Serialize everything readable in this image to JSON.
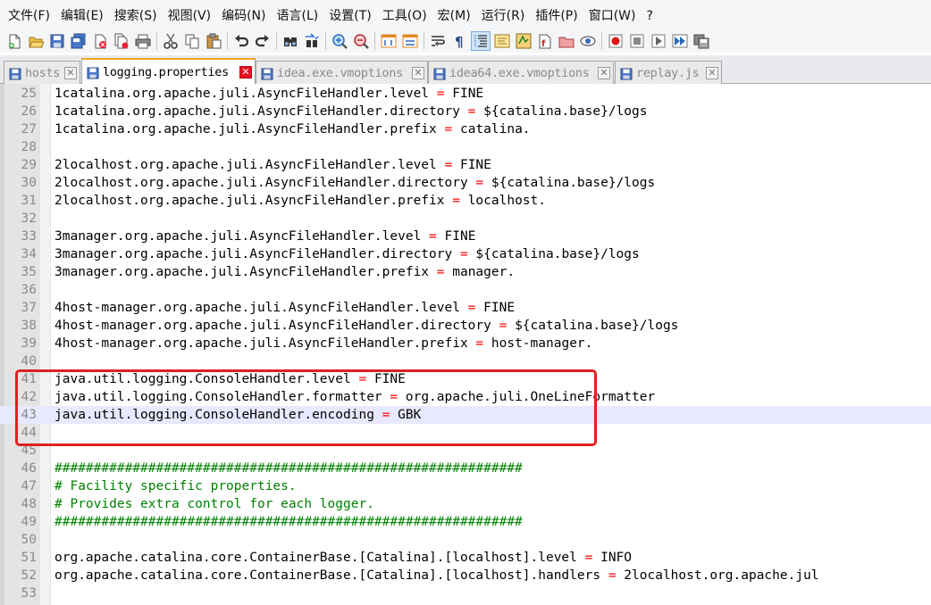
{
  "menubar": {
    "items": [
      "文件(F)",
      "编辑(E)",
      "搜索(S)",
      "视图(V)",
      "编码(N)",
      "语言(L)",
      "设置(T)",
      "工具(O)",
      "宏(M)",
      "运行(R)",
      "插件(P)",
      "窗口(W)",
      "?"
    ]
  },
  "toolbar": {
    "icons": [
      "new-file",
      "open-file",
      "save",
      "save-all",
      "close",
      "close-all",
      "print",
      "cut",
      "copy",
      "paste",
      "undo",
      "redo",
      "find",
      "replace",
      "zoom-in",
      "zoom-out",
      "sync-vertical",
      "sync-horizontal",
      "word-wrap",
      "show-all-characters",
      "indent-guide",
      "document-map",
      "function-list",
      "user-defined-language",
      "folder-as-workspace",
      "monitoring",
      "start-recording",
      "stop-recording",
      "playback",
      "run-macro-multiple",
      "save-recorded-macro"
    ]
  },
  "tabs": [
    {
      "label": "hosts",
      "active": false
    },
    {
      "label": "logging.properties",
      "active": true
    },
    {
      "label": "idea.exe.vmoptions",
      "active": false
    },
    {
      "label": "idea64.exe.vmoptions",
      "active": false
    },
    {
      "label": "replay.js",
      "active": false
    }
  ],
  "editor": {
    "current_line": 43,
    "lines": [
      {
        "n": "25",
        "key": "1catalina.org.apache.juli.AsyncFileHandler.level",
        "value": "FINE"
      },
      {
        "n": "26",
        "key": "1catalina.org.apache.juli.AsyncFileHandler.directory",
        "value": "${catalina.base}/logs"
      },
      {
        "n": "27",
        "key": "1catalina.org.apache.juli.AsyncFileHandler.prefix",
        "value": "catalina."
      },
      {
        "n": "28"
      },
      {
        "n": "29",
        "key": "2localhost.org.apache.juli.AsyncFileHandler.level",
        "value": "FINE"
      },
      {
        "n": "30",
        "key": "2localhost.org.apache.juli.AsyncFileHandler.directory",
        "value": "${catalina.base}/logs"
      },
      {
        "n": "31",
        "key": "2localhost.org.apache.juli.AsyncFileHandler.prefix",
        "value": "localhost."
      },
      {
        "n": "32"
      },
      {
        "n": "33",
        "key": "3manager.org.apache.juli.AsyncFileHandler.level",
        "value": "FINE"
      },
      {
        "n": "34",
        "key": "3manager.org.apache.juli.AsyncFileHandler.directory",
        "value": "${catalina.base}/logs"
      },
      {
        "n": "35",
        "key": "3manager.org.apache.juli.AsyncFileHandler.prefix",
        "value": "manager."
      },
      {
        "n": "36"
      },
      {
        "n": "37",
        "key": "4host-manager.org.apache.juli.AsyncFileHandler.level",
        "value": "FINE"
      },
      {
        "n": "38",
        "key": "4host-manager.org.apache.juli.AsyncFileHandler.directory",
        "value": "${catalina.base}/logs"
      },
      {
        "n": "39",
        "key": "4host-manager.org.apache.juli.AsyncFileHandler.prefix",
        "value": "host-manager."
      },
      {
        "n": "40"
      },
      {
        "n": "41",
        "key": "java.util.logging.ConsoleHandler.level",
        "value": "FINE"
      },
      {
        "n": "42",
        "key": "java.util.logging.ConsoleHandler.formatter",
        "value": "org.apache.juli.OneLineFormatter"
      },
      {
        "n": "43",
        "key": "java.util.logging.ConsoleHandler.encoding",
        "value": "GBK"
      },
      {
        "n": "44"
      },
      {
        "n": "45"
      },
      {
        "n": "46",
        "comment": "############################################################"
      },
      {
        "n": "47",
        "comment": "# Facility specific properties."
      },
      {
        "n": "48",
        "comment": "# Provides extra control for each logger."
      },
      {
        "n": "49",
        "comment": "############################################################"
      },
      {
        "n": "50"
      },
      {
        "n": "51",
        "key": "org.apache.catalina.core.ContainerBase.[Catalina].[localhost].level",
        "value": "INFO"
      },
      {
        "n": "52",
        "key": "org.apache.catalina.core.ContainerBase.[Catalina].[localhost].handlers",
        "value": "2localhost.org.apache.jul"
      },
      {
        "n": "53"
      }
    ]
  },
  "colors": {
    "operator": "#ff0000",
    "comment": "#008000",
    "current_line_bg": "#e8e8ff",
    "annotation_box": "#e02020",
    "active_tab_accent": "#f5a623"
  }
}
